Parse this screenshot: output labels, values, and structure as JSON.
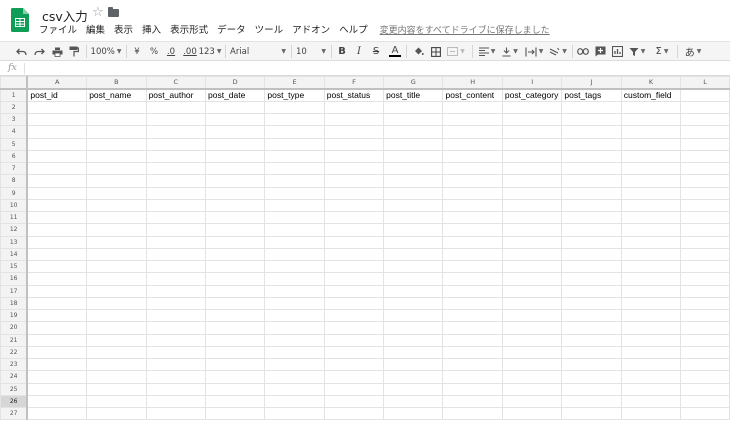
{
  "doc": {
    "title": "csv入力"
  },
  "menu": {
    "items": [
      "ファイル",
      "編集",
      "表示",
      "挿入",
      "表示形式",
      "データ",
      "ツール",
      "アドオン",
      "ヘルプ"
    ],
    "save_status": "変更内容をすべてドライブに保存しました"
  },
  "toolbar": {
    "zoom": "100%",
    "currency": "¥",
    "percent": "%",
    "decrease_decimals": ".0",
    "increase_decimals": ".00",
    "more_formats": "123",
    "font": "Arial",
    "font_size": "10",
    "bold": "B",
    "italic": "I",
    "strikethrough": "S",
    "text_color": "A",
    "input_tools": "あ"
  },
  "formula_bar": {
    "label": "fx",
    "value": ""
  },
  "grid": {
    "columns": [
      "A",
      "B",
      "C",
      "D",
      "E",
      "F",
      "G",
      "H",
      "I",
      "J",
      "K",
      "L"
    ],
    "selected_row": 26,
    "row_count": 27,
    "rows": [
      [
        "post_id",
        "post_name",
        "post_author",
        "post_date",
        "post_type",
        "post_status",
        "post_title",
        "post_content",
        "post_category",
        "post_tags",
        "custom_field",
        ""
      ]
    ]
  },
  "colors": {
    "sheets_green": "#0f9d58",
    "text_color_underline": "#000000"
  }
}
